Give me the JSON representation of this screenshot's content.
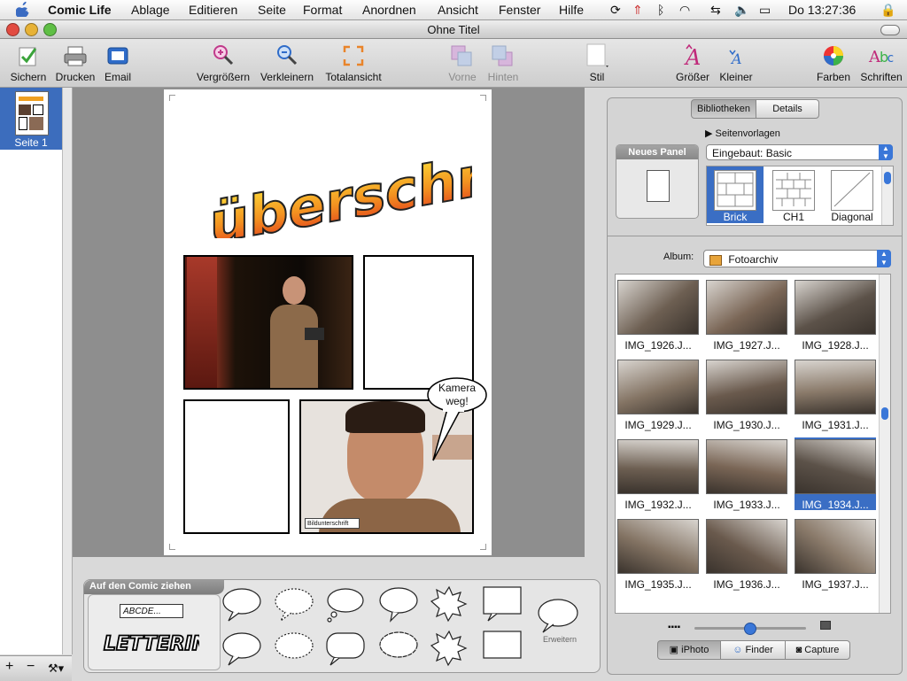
{
  "menubar": {
    "app_name": "Comic Life",
    "items": [
      "Ablage",
      "Editieren",
      "Seite",
      "Format",
      "Anordnen",
      "Ansicht",
      "Fenster",
      "Hilfe"
    ],
    "clock": "Do 13:27:36"
  },
  "window": {
    "title": "Ohne Titel"
  },
  "toolbar": {
    "save": "Sichern",
    "print": "Drucken",
    "email": "Email",
    "zoom_in": "Vergrößern",
    "zoom_out": "Verkleinern",
    "fit": "Totalansicht",
    "front": "Vorne",
    "back": "Hinten",
    "style": "Stil",
    "bigger": "Größer",
    "smaller": "Kleiner",
    "colors": "Farben",
    "fonts": "Schriften"
  },
  "pages": {
    "items": [
      {
        "label": "Seite 1"
      }
    ]
  },
  "comic": {
    "heading": "überschrift",
    "balloon": "Kamera weg!",
    "caption": "Bildunterschrift"
  },
  "lettering": {
    "tab": "Auf den Comic ziehen",
    "caption_sample": "ABCDE...",
    "lettering_sample": "LETTERING",
    "expand": "Erweitern"
  },
  "inspector": {
    "tabs": [
      "Bibliotheken",
      "Details"
    ],
    "templates_label": "Seitenvorlagen",
    "new_panel": "Neues Panel",
    "template_set": "Eingebaut: Basic",
    "templates": [
      "Brick",
      "CH1",
      "Diagonal"
    ],
    "album_label": "Album:",
    "album": "Fotoarchiv",
    "photos": [
      "IMG_1926.J...",
      "IMG_1927.J...",
      "IMG_1928.J...",
      "IMG_1929.J...",
      "IMG_1930.J...",
      "IMG_1931.J...",
      "IMG_1932.J...",
      "IMG_1933.J...",
      "IMG_1934.J...",
      "IMG_1935.J...",
      "IMG_1936.J...",
      "IMG_1937.J..."
    ],
    "selected_photo": "IMG_1934.J...",
    "sources": [
      "iPhoto",
      "Finder",
      "Capture"
    ]
  },
  "colors": {
    "selection": "#3c6dbd",
    "accent": "#3a77d8"
  }
}
